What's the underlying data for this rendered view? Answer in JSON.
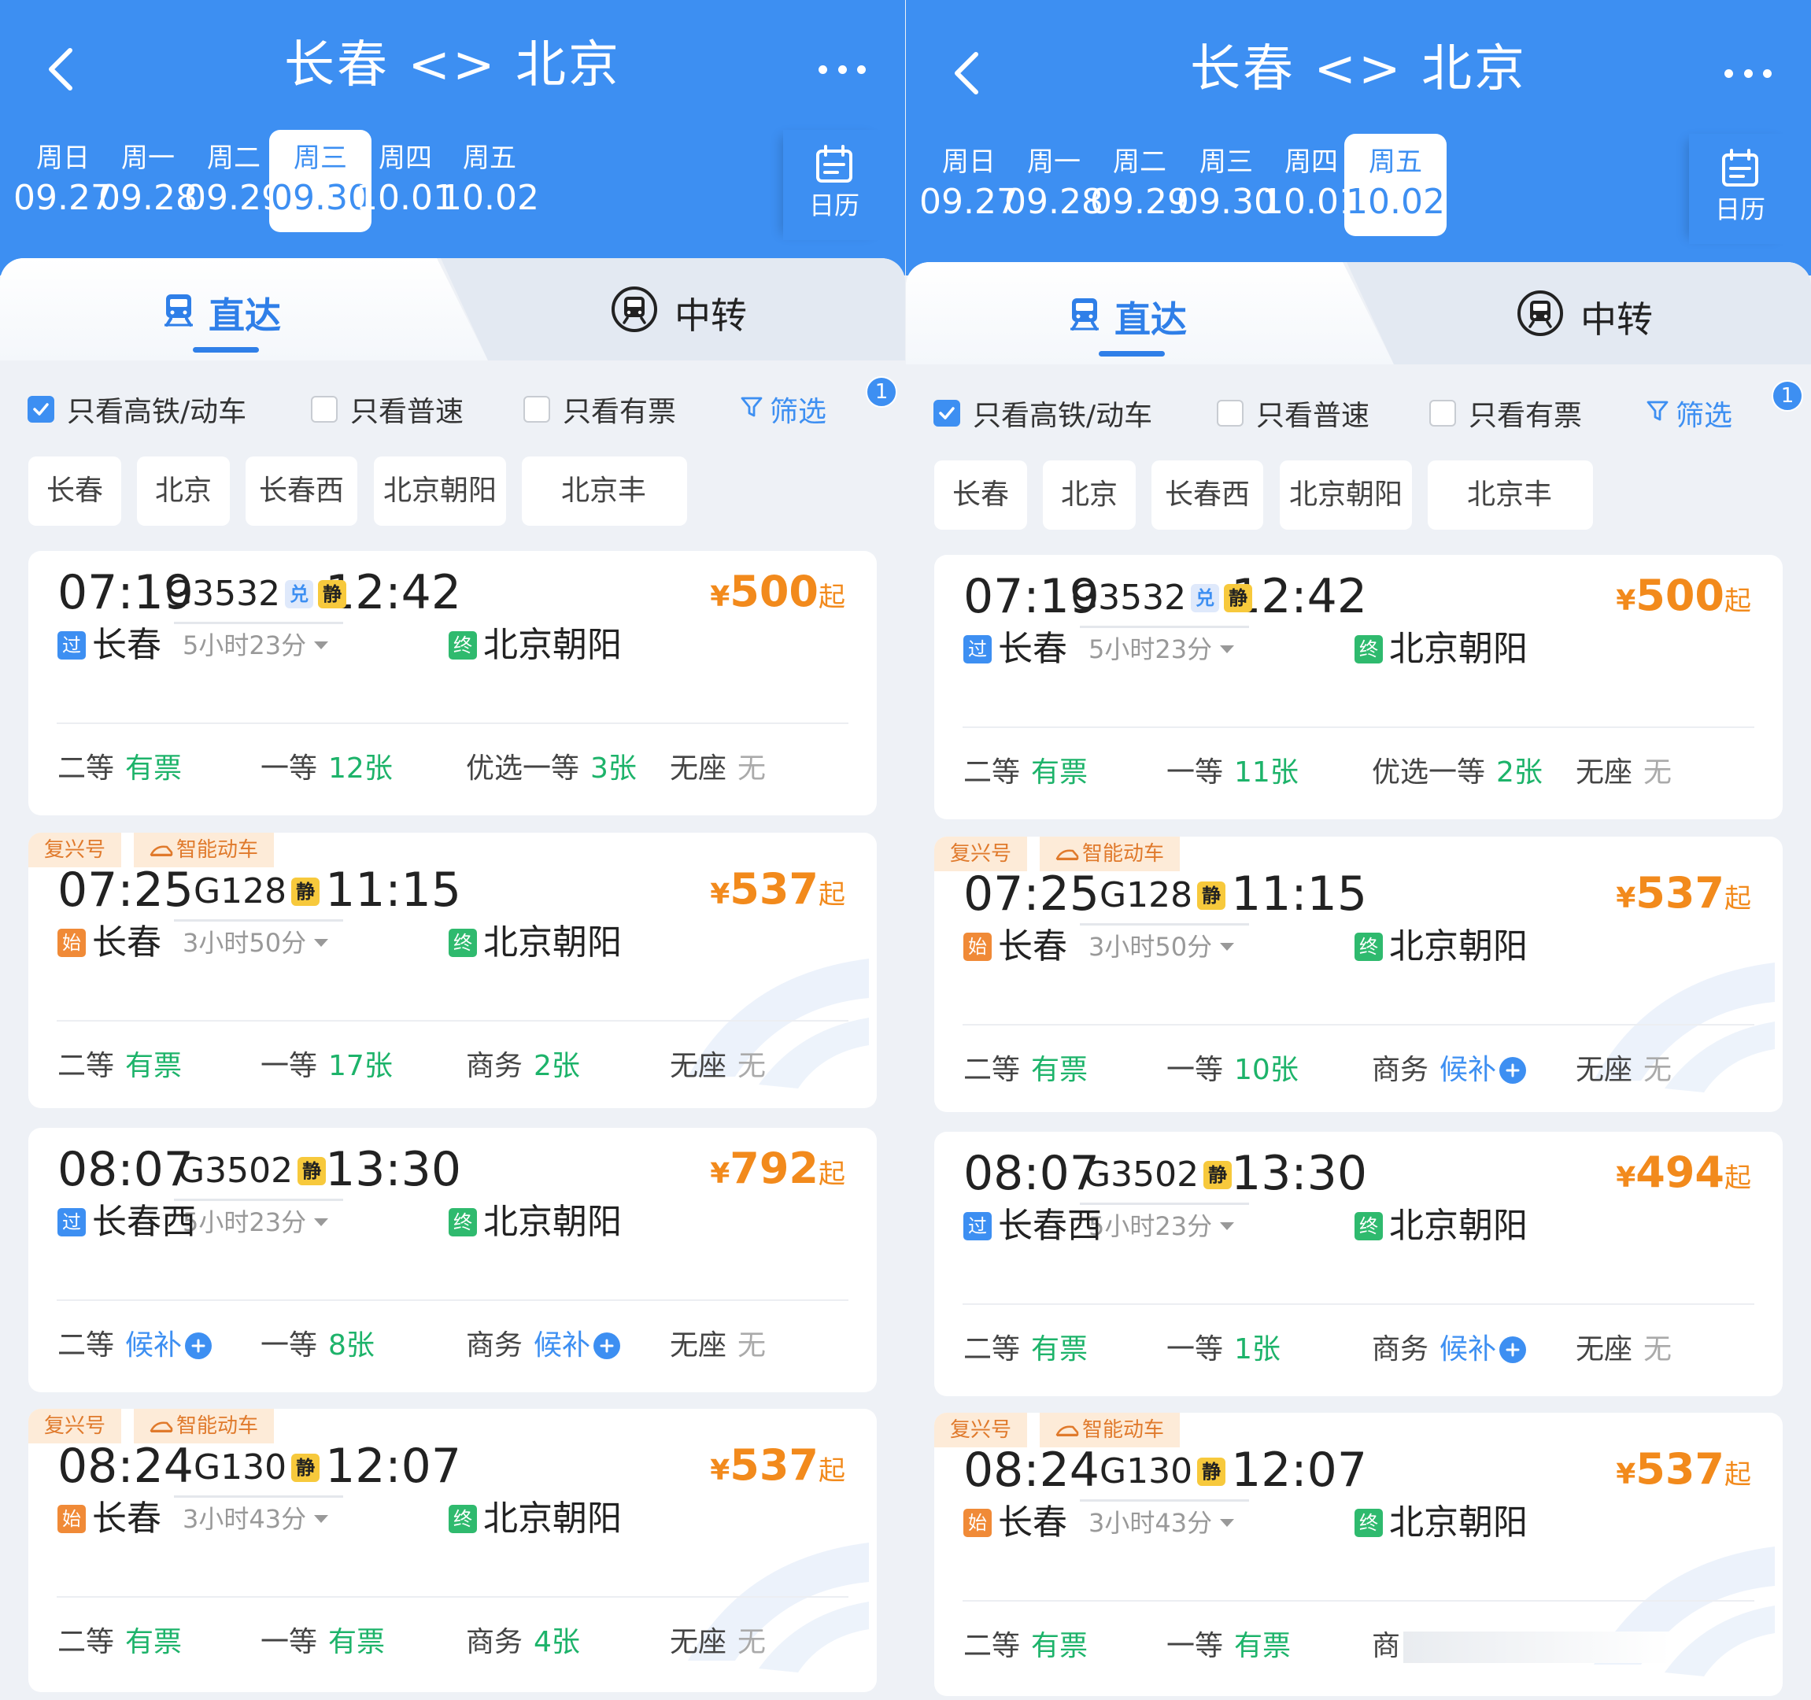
{
  "panels": [
    {
      "title": "长春 <> 北京",
      "dates": [
        {
          "week": "周日",
          "date": "09.27"
        },
        {
          "week": "周一",
          "date": "09.28"
        },
        {
          "week": "周二",
          "date": "09.29"
        },
        {
          "week": "周三",
          "date": "09.30"
        },
        {
          "week": "周四",
          "date": "10.01"
        },
        {
          "week": "周五",
          "date": "10.02"
        }
      ],
      "selected_date_index": 3,
      "calendar_label": "日历",
      "tabs": {
        "direct": "直达",
        "transfer": "中转"
      },
      "filters": {
        "high_speed": "只看高铁/动车",
        "normal": "只看普速",
        "has_ticket": "只看有票",
        "screen": "筛选",
        "screen_badge": "1"
      },
      "stations": [
        "长春",
        "北京",
        "长春西",
        "北京朝阳",
        "北京丰"
      ],
      "trains": [
        {
          "tags": [],
          "depart": "07:19",
          "arrive": "12:42",
          "train_no": "G3532",
          "dui": "兑",
          "jing": "静",
          "duration": "5小时23分",
          "from_mark": "过",
          "from": "长春",
          "to_mark": "终",
          "to": "北京朝阳",
          "price_currency": "¥",
          "price": "500",
          "price_suffix": "起",
          "seats": [
            {
              "cls": "二等",
              "val": "有票",
              "color": "green"
            },
            {
              "cls": "一等",
              "val": "12张",
              "color": "green"
            },
            {
              "cls": "优选一等",
              "val": "3张",
              "color": "green"
            },
            {
              "cls": "无座",
              "val": "无",
              "color": "gray"
            }
          ]
        },
        {
          "tags": [
            "复兴号",
            "智能动车"
          ],
          "depart": "07:25",
          "arrive": "11:15",
          "train_no": "G128",
          "dui": "",
          "jing": "静",
          "duration": "3小时50分",
          "from_mark": "始",
          "from": "长春",
          "to_mark": "终",
          "to": "北京朝阳",
          "price_currency": "¥",
          "price": "537",
          "price_suffix": "起",
          "seats": [
            {
              "cls": "二等",
              "val": "有票",
              "color": "green"
            },
            {
              "cls": "一等",
              "val": "17张",
              "color": "green"
            },
            {
              "cls": "商务",
              "val": "2张",
              "color": "green"
            },
            {
              "cls": "无座",
              "val": "无",
              "color": "gray"
            }
          ]
        },
        {
          "tags": [],
          "depart": "08:07",
          "arrive": "13:30",
          "train_no": "G3502",
          "dui": "",
          "jing": "静",
          "duration": "5小时23分",
          "from_mark": "过",
          "from": "长春西",
          "to_mark": "终",
          "to": "北京朝阳",
          "price_currency": "¥",
          "price": "792",
          "price_suffix": "起",
          "seats": [
            {
              "cls": "二等",
              "val": "候补",
              "color": "blue",
              "plus": true
            },
            {
              "cls": "一等",
              "val": "8张",
              "color": "green"
            },
            {
              "cls": "商务",
              "val": "候补",
              "color": "blue",
              "plus": true
            },
            {
              "cls": "无座",
              "val": "无",
              "color": "gray"
            }
          ]
        },
        {
          "tags": [
            "复兴号",
            "智能动车"
          ],
          "depart": "08:24",
          "arrive": "12:07",
          "train_no": "G130",
          "dui": "",
          "jing": "静",
          "duration": "3小时43分",
          "from_mark": "始",
          "from": "长春",
          "to_mark": "终",
          "to": "北京朝阳",
          "price_currency": "¥",
          "price": "537",
          "price_suffix": "起",
          "seats": [
            {
              "cls": "二等",
              "val": "有票",
              "color": "green"
            },
            {
              "cls": "一等",
              "val": "有票",
              "color": "green"
            },
            {
              "cls": "商务",
              "val": "4张",
              "color": "green"
            },
            {
              "cls": "无座",
              "val": "无",
              "color": "gray"
            }
          ]
        }
      ]
    },
    {
      "title": "长春 <> 北京",
      "dates": [
        {
          "week": "周日",
          "date": "09.27"
        },
        {
          "week": "周一",
          "date": "09.28"
        },
        {
          "week": "周二",
          "date": "09.29"
        },
        {
          "week": "周三",
          "date": "09.30"
        },
        {
          "week": "周四",
          "date": "10.01"
        },
        {
          "week": "周五",
          "date": "10.02"
        }
      ],
      "selected_date_index": 5,
      "calendar_label": "日历",
      "tabs": {
        "direct": "直达",
        "transfer": "中转"
      },
      "filters": {
        "high_speed": "只看高铁/动车",
        "normal": "只看普速",
        "has_ticket": "只看有票",
        "screen": "筛选",
        "screen_badge": "1"
      },
      "stations": [
        "长春",
        "北京",
        "长春西",
        "北京朝阳",
        "北京丰"
      ],
      "trains": [
        {
          "tags": [],
          "depart": "07:19",
          "arrive": "12:42",
          "train_no": "G3532",
          "dui": "兑",
          "jing": "静",
          "duration": "5小时23分",
          "from_mark": "过",
          "from": "长春",
          "to_mark": "终",
          "to": "北京朝阳",
          "price_currency": "¥",
          "price": "500",
          "price_suffix": "起",
          "seats": [
            {
              "cls": "二等",
              "val": "有票",
              "color": "green"
            },
            {
              "cls": "一等",
              "val": "11张",
              "color": "green"
            },
            {
              "cls": "优选一等",
              "val": "2张",
              "color": "green"
            },
            {
              "cls": "无座",
              "val": "无",
              "color": "gray"
            }
          ]
        },
        {
          "tags": [
            "复兴号",
            "智能动车"
          ],
          "depart": "07:25",
          "arrive": "11:15",
          "train_no": "G128",
          "dui": "",
          "jing": "静",
          "duration": "3小时50分",
          "from_mark": "始",
          "from": "长春",
          "to_mark": "终",
          "to": "北京朝阳",
          "price_currency": "¥",
          "price": "537",
          "price_suffix": "起",
          "seats": [
            {
              "cls": "二等",
              "val": "有票",
              "color": "green"
            },
            {
              "cls": "一等",
              "val": "10张",
              "color": "green"
            },
            {
              "cls": "商务",
              "val": "候补",
              "color": "blue",
              "plus": true
            },
            {
              "cls": "无座",
              "val": "无",
              "color": "gray"
            }
          ]
        },
        {
          "tags": [],
          "depart": "08:07",
          "arrive": "13:30",
          "train_no": "G3502",
          "dui": "",
          "jing": "静",
          "duration": "5小时23分",
          "from_mark": "过",
          "from": "长春西",
          "to_mark": "终",
          "to": "北京朝阳",
          "price_currency": "¥",
          "price": "494",
          "price_suffix": "起",
          "seats": [
            {
              "cls": "二等",
              "val": "有票",
              "color": "green"
            },
            {
              "cls": "一等",
              "val": "1张",
              "color": "green"
            },
            {
              "cls": "商务",
              "val": "候补",
              "color": "blue",
              "plus": true
            },
            {
              "cls": "无座",
              "val": "无",
              "color": "gray"
            }
          ]
        },
        {
          "tags": [
            "复兴号",
            "智能动车"
          ],
          "depart": "08:24",
          "arrive": "12:07",
          "train_no": "G130",
          "dui": "",
          "jing": "静",
          "duration": "3小时43分",
          "from_mark": "始",
          "from": "长春",
          "to_mark": "终",
          "to": "北京朝阳",
          "price_currency": "¥",
          "price": "537",
          "price_suffix": "起",
          "seats": [
            {
              "cls": "二等",
              "val": "有票",
              "color": "green"
            },
            {
              "cls": "一等",
              "val": "有票",
              "color": "green"
            },
            {
              "cls": "商",
              "val": "",
              "color": "gray",
              "covered": true
            }
          ]
        }
      ]
    }
  ],
  "colors": {
    "primary": "#3d8ff2",
    "price": "#f28a1c",
    "available": "#1db36a",
    "waitlist": "#3d8ff2",
    "none": "#aaaaaa"
  }
}
